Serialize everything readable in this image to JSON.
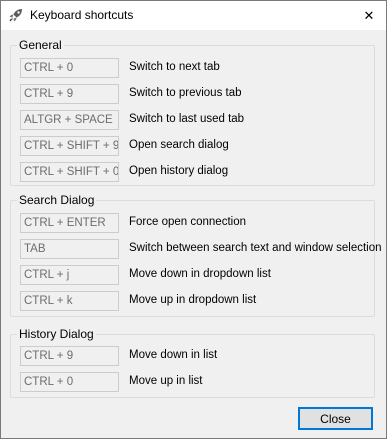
{
  "window": {
    "title": "Keyboard shortcuts",
    "close_glyph": "✕"
  },
  "groups": [
    {
      "title": "General",
      "rows": [
        {
          "keys": "CTRL + 0",
          "desc": "Switch to next tab"
        },
        {
          "keys": "CTRL + 9",
          "desc": "Switch to previous tab"
        },
        {
          "keys": "ALTGR + SPACE",
          "desc": "Switch to last used tab"
        },
        {
          "keys": "CTRL + SHIFT + 9",
          "desc": "Open search dialog"
        },
        {
          "keys": "CTRL + SHIFT + 0",
          "desc": "Open history dialog"
        }
      ]
    },
    {
      "title": "Search Dialog",
      "rows": [
        {
          "keys": "CTRL + ENTER",
          "desc": "Force open connection"
        },
        {
          "keys": "TAB",
          "desc": "Switch between search text and window selection"
        },
        {
          "keys": "CTRL + j",
          "desc": "Move down in dropdown list"
        },
        {
          "keys": "CTRL + k",
          "desc": "Move up in dropdown list"
        }
      ]
    },
    {
      "title": "History Dialog",
      "rows": [
        {
          "keys": "CTRL + 9",
          "desc": "Move down in list"
        },
        {
          "keys": "CTRL + 0",
          "desc": "Move up in list"
        }
      ]
    }
  ],
  "footer": {
    "close_label": "Close"
  },
  "colors": {
    "accent": "#0078d7",
    "window_bg": "#f0f0f0",
    "field_text": "#6d6d6d"
  }
}
